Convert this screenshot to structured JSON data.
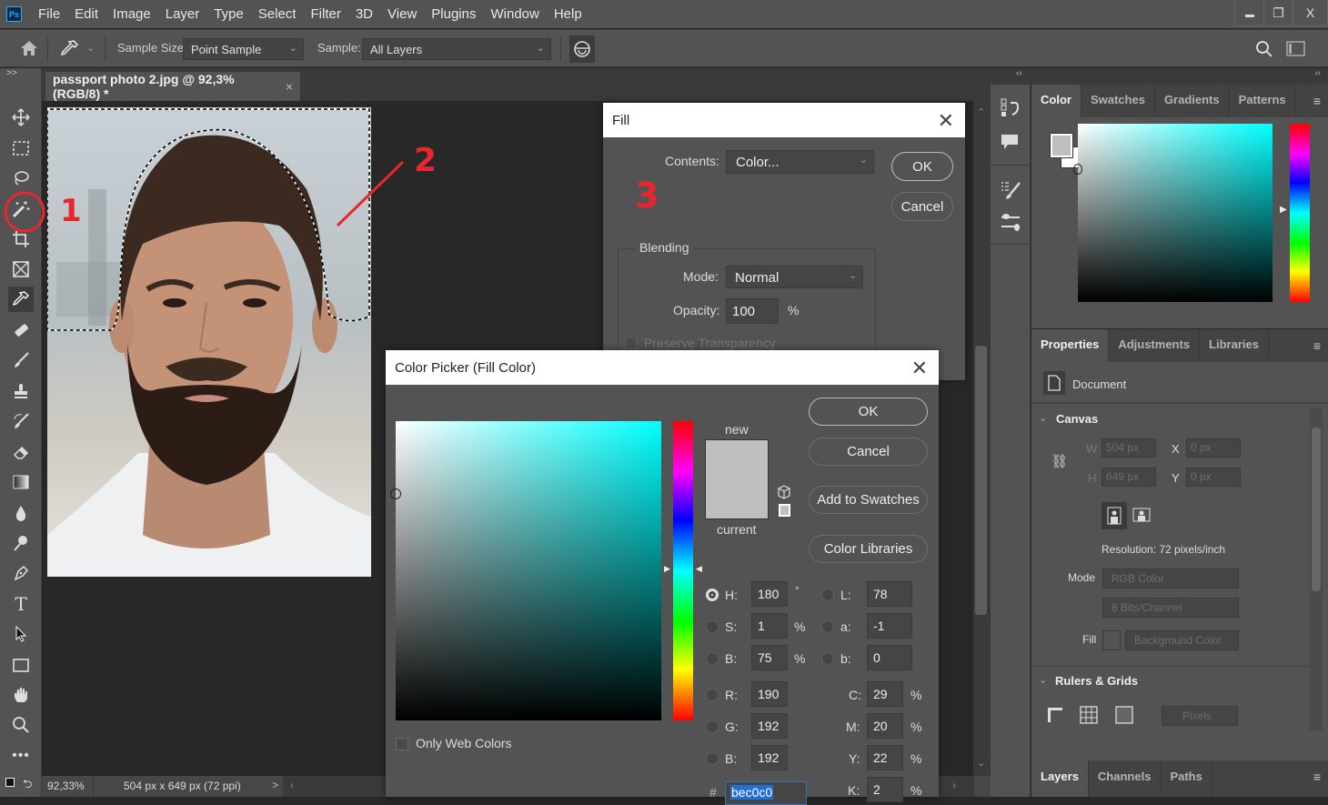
{
  "menubar": {
    "logo": "Ps",
    "items": [
      "File",
      "Edit",
      "Image",
      "Layer",
      "Type",
      "Select",
      "Filter",
      "3D",
      "View",
      "Plugins",
      "Window",
      "Help"
    ],
    "window_controls": [
      "minimize",
      "restore",
      "close"
    ]
  },
  "options_bar": {
    "sample_size_label": "Sample Size:",
    "sample_size_value": "Point Sample",
    "sample_label": "Sample:",
    "sample_value": "All Layers"
  },
  "toolbar": {
    "tools": [
      "move",
      "rectangular-marquee",
      "lasso",
      "magic-wand",
      "crop",
      "frame",
      "eyedropper",
      "spot-healing",
      "brush",
      "clone-stamp",
      "history-brush",
      "eraser",
      "gradient",
      "blur",
      "dodge",
      "pen",
      "type",
      "path-selection",
      "rectangle",
      "hand",
      "zoom",
      "more"
    ],
    "active_tool": "eyedropper",
    "expand_label": ">>"
  },
  "document": {
    "tab_title": "passport photo 2.jpg @ 92,3% (RGB/8) *",
    "close_label": "×"
  },
  "status_bar": {
    "zoom": "92,33%",
    "doc_info": "504 px x 649 px (72 ppi)",
    "arrow": ">"
  },
  "annotations": {
    "one": "1",
    "two": "2",
    "three": "3"
  },
  "fill_dialog": {
    "title": "Fill",
    "contents_label": "Contents:",
    "contents_value": "Color...",
    "ok": "OK",
    "cancel": "Cancel",
    "blending_label": "Blending",
    "mode_label": "Mode:",
    "mode_value": "Normal",
    "opacity_label": "Opacity:",
    "opacity_value": "100",
    "opacity_unit": "%",
    "preserve_label": "Preserve Transparency"
  },
  "color_picker": {
    "title": "Color Picker (Fill Color)",
    "new_label": "new",
    "current_label": "current",
    "new_color": "#bec0c0",
    "current_color": "#bec0c0",
    "ok": "OK",
    "cancel": "Cancel",
    "add_swatches": "Add to Swatches",
    "color_libraries": "Color Libraries",
    "only_web_label": "Only Web Colors",
    "selected_channel": "H",
    "hsb": [
      {
        "label": "H:",
        "value": "180",
        "unit": "°"
      },
      {
        "label": "S:",
        "value": "1",
        "unit": "%"
      },
      {
        "label": "B:",
        "value": "75",
        "unit": "%"
      }
    ],
    "lab": [
      {
        "label": "L:",
        "value": "78"
      },
      {
        "label": "a:",
        "value": "-1"
      },
      {
        "label": "b:",
        "value": "0"
      }
    ],
    "rgb": [
      {
        "label": "R:",
        "value": "190"
      },
      {
        "label": "G:",
        "value": "192"
      },
      {
        "label": "B:",
        "value": "192"
      }
    ],
    "cmyk": [
      {
        "label": "C:",
        "value": "29",
        "unit": "%"
      },
      {
        "label": "M:",
        "value": "20",
        "unit": "%"
      },
      {
        "label": "Y:",
        "value": "22",
        "unit": "%"
      },
      {
        "label": "K:",
        "value": "2",
        "unit": "%"
      }
    ],
    "hex_label": "#",
    "hex_value": "bec0c0",
    "hue_color": "#00ffff"
  },
  "color_panel": {
    "tabs": [
      "Color",
      "Swatches",
      "Gradients",
      "Patterns"
    ],
    "active_tab": "Color",
    "foreground": "#bec0c0",
    "background": "#ffffff"
  },
  "properties_panel": {
    "tabs": [
      "Properties",
      "Adjustments",
      "Libraries"
    ],
    "active_tab": "Properties",
    "document_label": "Document",
    "canvas_section": "Canvas",
    "w_label": "W",
    "w_value": "504 px",
    "h_label": "H",
    "h_value": "649 px",
    "x_label": "X",
    "x_value": "0 px",
    "y_label": "Y",
    "y_value": "0 px",
    "resolution": "Resolution: 72 pixels/inch",
    "mode_label": "Mode",
    "mode_value": "RGB Color",
    "bits_value": "8 Bits/Channel",
    "fill_label": "Fill",
    "fill_value": "Background Color",
    "rulers_section": "Rulers & Grids",
    "units_value": "Pixels"
  },
  "layers_panel": {
    "tabs": [
      "Layers",
      "Channels",
      "Paths"
    ],
    "active_tab": "Layers"
  }
}
